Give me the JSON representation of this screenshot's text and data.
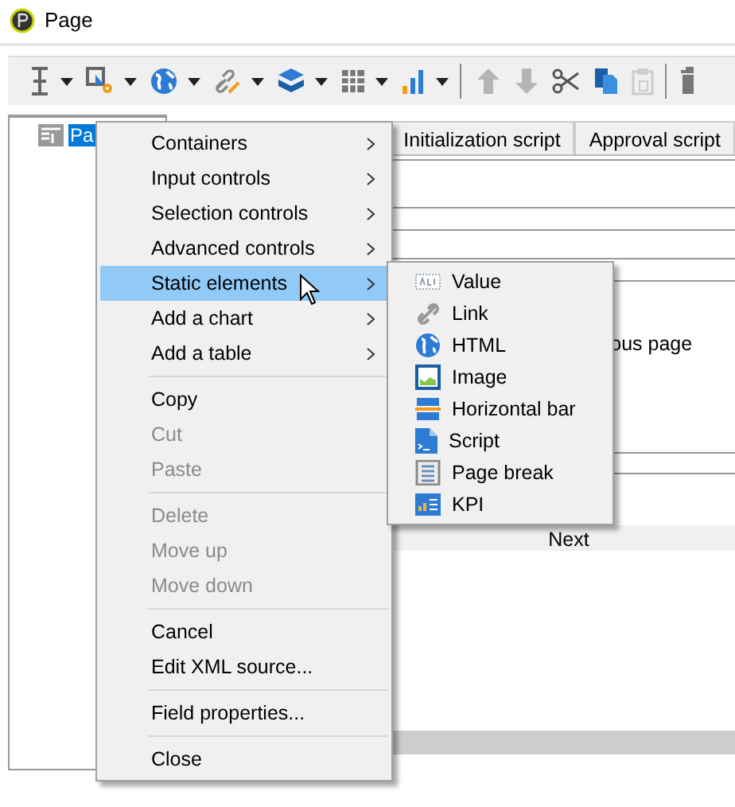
{
  "window": {
    "title": "Page"
  },
  "toolbar": [
    {
      "kind": "text",
      "dropdown": true,
      "disabled": false
    },
    {
      "kind": "input",
      "dropdown": true,
      "disabled": false
    },
    {
      "kind": "globe",
      "dropdown": true,
      "disabled": false
    },
    {
      "kind": "link",
      "dropdown": true,
      "disabled": false
    },
    {
      "kind": "layers",
      "dropdown": true,
      "disabled": false
    },
    {
      "kind": "grid",
      "dropdown": true,
      "disabled": false
    },
    {
      "kind": "chart",
      "dropdown": true,
      "disabled": false
    },
    {
      "kind": "separator"
    },
    {
      "kind": "up",
      "dropdown": false,
      "disabled": true
    },
    {
      "kind": "down",
      "dropdown": false,
      "disabled": true
    },
    {
      "kind": "cut",
      "dropdown": false,
      "disabled": false
    },
    {
      "kind": "copy",
      "dropdown": false,
      "disabled": false
    },
    {
      "kind": "paste",
      "dropdown": false,
      "disabled": true
    },
    {
      "kind": "separator"
    },
    {
      "kind": "delete",
      "dropdown": false,
      "disabled": false
    }
  ],
  "tree": {
    "items": [
      {
        "label": "Pa",
        "selected": true
      }
    ]
  },
  "tabs": [
    {
      "label": "Initialization script",
      "selected": false
    },
    {
      "label": "Approval script",
      "selected": false
    }
  ],
  "form": {
    "partial_text": "ous page",
    "button": "Next"
  },
  "context_menu": {
    "groups": [
      [
        {
          "label": "Containers",
          "submenu": true,
          "disabled": false,
          "selected": false
        },
        {
          "label": "Input controls",
          "submenu": true,
          "disabled": false,
          "selected": false
        },
        {
          "label": "Selection controls",
          "submenu": true,
          "disabled": false,
          "selected": false
        },
        {
          "label": "Advanced controls",
          "submenu": true,
          "disabled": false,
          "selected": false
        },
        {
          "label": "Static elements",
          "submenu": true,
          "disabled": false,
          "selected": true
        },
        {
          "label": "Add a chart",
          "submenu": true,
          "disabled": false,
          "selected": false
        },
        {
          "label": "Add a table",
          "submenu": true,
          "disabled": false,
          "selected": false
        }
      ],
      [
        {
          "label": "Copy",
          "submenu": false,
          "disabled": false,
          "selected": false
        },
        {
          "label": "Cut",
          "submenu": false,
          "disabled": true,
          "selected": false
        },
        {
          "label": "Paste",
          "submenu": false,
          "disabled": true,
          "selected": false
        }
      ],
      [
        {
          "label": "Delete",
          "submenu": false,
          "disabled": true,
          "selected": false
        },
        {
          "label": "Move up",
          "submenu": false,
          "disabled": true,
          "selected": false
        },
        {
          "label": "Move down",
          "submenu": false,
          "disabled": true,
          "selected": false
        }
      ],
      [
        {
          "label": "Cancel",
          "submenu": false,
          "disabled": false,
          "selected": false
        },
        {
          "label": "Edit XML source...",
          "submenu": false,
          "disabled": false,
          "selected": false
        }
      ],
      [
        {
          "label": "Field properties...",
          "submenu": false,
          "disabled": false,
          "selected": false
        }
      ],
      [
        {
          "label": "Close",
          "submenu": false,
          "disabled": false,
          "selected": false
        }
      ]
    ]
  },
  "submenu": {
    "items": [
      {
        "label": "Value",
        "kind": "value"
      },
      {
        "label": "Link",
        "kind": "link"
      },
      {
        "label": "HTML",
        "kind": "html"
      },
      {
        "label": "Image",
        "kind": "image"
      },
      {
        "label": "Horizontal bar",
        "kind": "hbar"
      },
      {
        "label": "Script",
        "kind": "script"
      },
      {
        "label": "Page break",
        "kind": "pagebreak"
      },
      {
        "label": "KPI",
        "kind": "kpi"
      }
    ]
  }
}
